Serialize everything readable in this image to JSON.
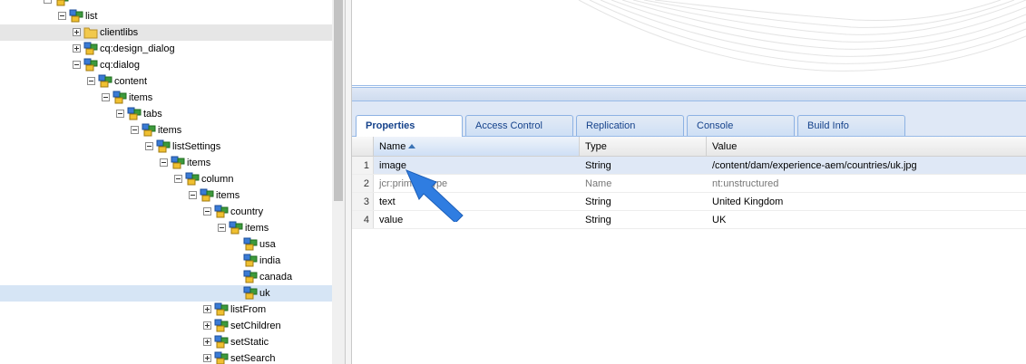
{
  "tree": {
    "nodes": [
      {
        "label": "",
        "expander": "minus",
        "icon": "node-icon"
      },
      {
        "label": "list",
        "expander": "minus",
        "icon": "node-icon"
      },
      {
        "label": "clientlibs",
        "expander": "plus",
        "icon": "folder-icon"
      },
      {
        "label": "cq:design_dialog",
        "expander": "plus",
        "icon": "node-icon"
      },
      {
        "label": "cq:dialog",
        "expander": "minus",
        "icon": "node-icon"
      },
      {
        "label": "content",
        "expander": "minus",
        "icon": "node-icon"
      },
      {
        "label": "items",
        "expander": "minus",
        "icon": "node-icon"
      },
      {
        "label": "tabs",
        "expander": "minus",
        "icon": "node-icon"
      },
      {
        "label": "items",
        "expander": "minus",
        "icon": "node-icon"
      },
      {
        "label": "listSettings",
        "expander": "minus",
        "icon": "node-icon"
      },
      {
        "label": "items",
        "expander": "minus",
        "icon": "node-icon"
      },
      {
        "label": "column",
        "expander": "minus",
        "icon": "node-icon"
      },
      {
        "label": "items",
        "expander": "minus",
        "icon": "node-icon"
      },
      {
        "label": "country",
        "expander": "minus",
        "icon": "node-icon"
      },
      {
        "label": "items",
        "expander": "minus",
        "icon": "node-icon"
      },
      {
        "label": "usa",
        "expander": "none",
        "icon": "node-icon"
      },
      {
        "label": "india",
        "expander": "none",
        "icon": "node-icon"
      },
      {
        "label": "canada",
        "expander": "none",
        "icon": "node-icon"
      },
      {
        "label": "uk",
        "expander": "none",
        "icon": "node-icon"
      },
      {
        "label": "listFrom",
        "expander": "plus",
        "icon": "node-icon"
      },
      {
        "label": "setChildren",
        "expander": "plus",
        "icon": "node-icon"
      },
      {
        "label": "setStatic",
        "expander": "plus",
        "icon": "node-icon"
      },
      {
        "label": "setSearch",
        "expander": "plus",
        "icon": "node-icon"
      }
    ]
  },
  "tabs": [
    {
      "label": "Properties",
      "active": true
    },
    {
      "label": "Access Control",
      "active": false
    },
    {
      "label": "Replication",
      "active": false
    },
    {
      "label": "Console",
      "active": false
    },
    {
      "label": "Build Info",
      "active": false
    }
  ],
  "grid": {
    "columns": [
      "Name",
      "Type",
      "Value"
    ],
    "sorted_column": "Name",
    "rows": [
      {
        "num": "1",
        "name": "image",
        "type": "String",
        "value": "/content/dam/experience-aem/countries/uk.jpg",
        "selected": true
      },
      {
        "num": "2",
        "name": "jcr:primaryType",
        "type": "Name",
        "value": "nt:unstructured",
        "selected": false
      },
      {
        "num": "3",
        "name": "text",
        "type": "String",
        "value": "United Kingdom",
        "selected": false
      },
      {
        "num": "4",
        "name": "value",
        "type": "String",
        "value": "UK",
        "selected": false
      }
    ]
  },
  "colors": {
    "tab_text": "#15428b",
    "row_selected": "#dfe8f6",
    "callout_arrow": "#2f7de1"
  }
}
